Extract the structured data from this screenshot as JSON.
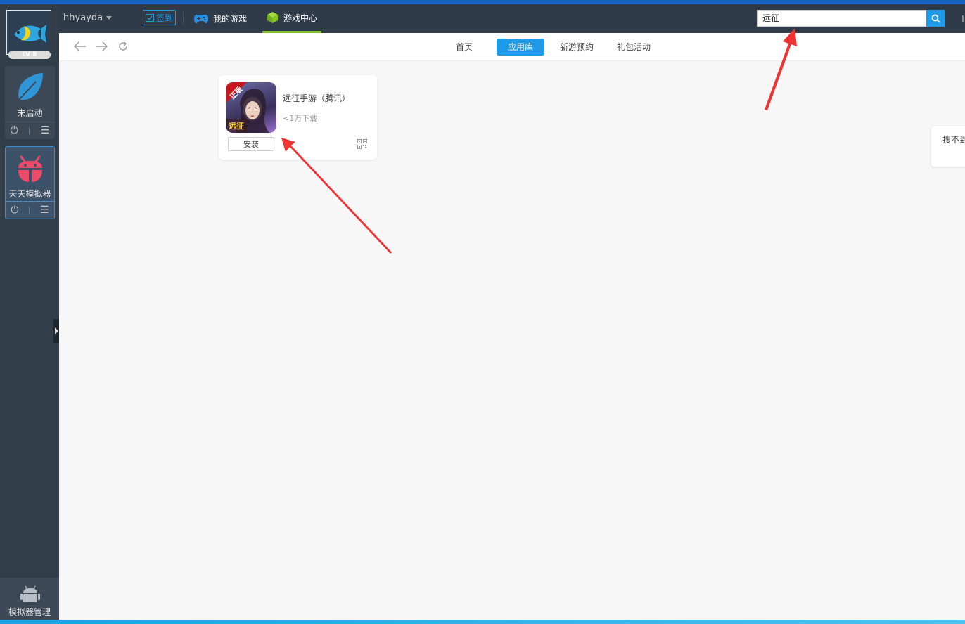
{
  "user": {
    "name": "hhyayda",
    "level": "LV 8"
  },
  "sidebar": {
    "emulators": [
      {
        "label": "未启动",
        "power_icon": "power-icon",
        "menu_icon": "menu-icon"
      },
      {
        "label": "天天模拟器",
        "power_icon": "power-icon",
        "menu_icon": "menu-icon"
      }
    ],
    "manager_label": "模拟器管理"
  },
  "topbar": {
    "signin_label": "签到",
    "tabs": [
      {
        "label": "我的游戏",
        "icon": "gamepad-icon"
      },
      {
        "label": "游戏中心",
        "icon": "cube-icon"
      }
    ],
    "search": {
      "value": "远征",
      "icon": "search-icon"
    }
  },
  "navbar": {
    "tabs": [
      "首页",
      "应用库",
      "新游预约",
      "礼包活动"
    ],
    "active_tab": "应用库"
  },
  "result": {
    "name": "远征手游（腾讯）",
    "downloads": "<1万下载",
    "install_label": "安装",
    "icon_badge_top": "正版",
    "icon_badge_bottom": "远征"
  },
  "notfound_text": "搜不到",
  "colors": {
    "accent": "#1e9be8",
    "active_tab_underline": "#7ec022",
    "annotation_arrow": "#f03232"
  }
}
